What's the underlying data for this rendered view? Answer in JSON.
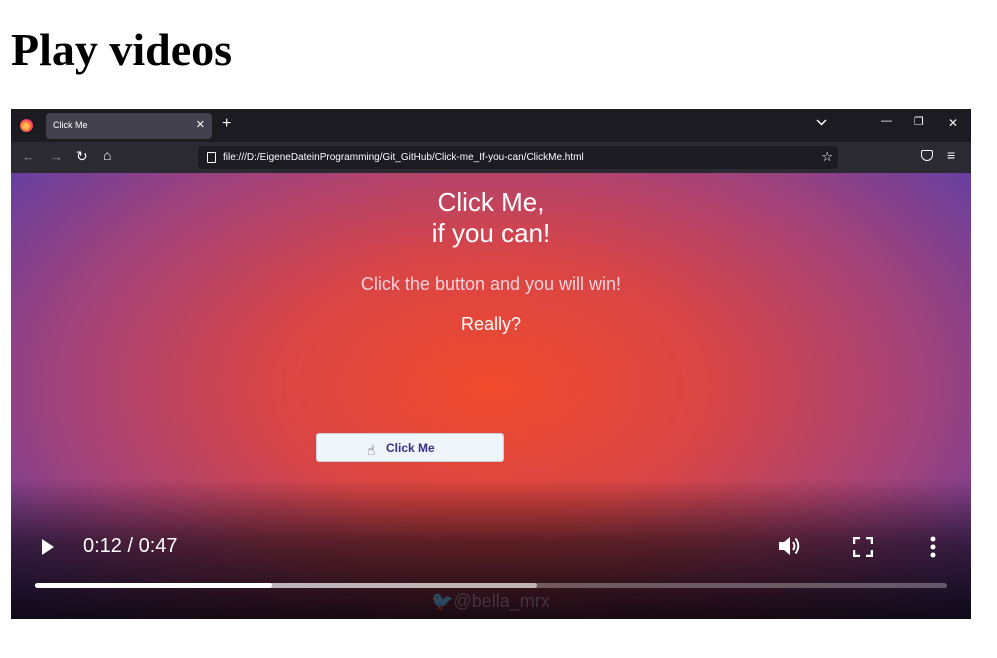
{
  "page": {
    "title": "Play videos"
  },
  "video": {
    "browser": {
      "tab_title": "Click Me",
      "url": "file:///D:/EigeneDateinProgramming/Git_GitHub/Click-me_If-you-can/ClickMe.html",
      "icons": [
        "firefox-logo",
        "close-icon",
        "plus-icon",
        "chevron-down-icon",
        "minimize-icon",
        "restore-icon",
        "window-close-icon",
        "back-arrow-icon",
        "forward-arrow-icon",
        "reload-icon",
        "home-icon",
        "page-icon",
        "star-icon",
        "pocket-icon",
        "menu-icon"
      ]
    },
    "app": {
      "heading_line1": "Click Me,",
      "heading_line2": "if you can!",
      "subtitle": "Click the button and you will win!",
      "really": "Really?",
      "button_label": "Click Me"
    },
    "watermark": "@bella_mrx",
    "controls": {
      "time": "0:12 / 0:47",
      "played_fraction": 0.26,
      "buffered_fraction": 0.55,
      "icons": [
        "play-icon",
        "volume-icon",
        "fullscreen-icon",
        "more-vert-icon"
      ]
    }
  }
}
